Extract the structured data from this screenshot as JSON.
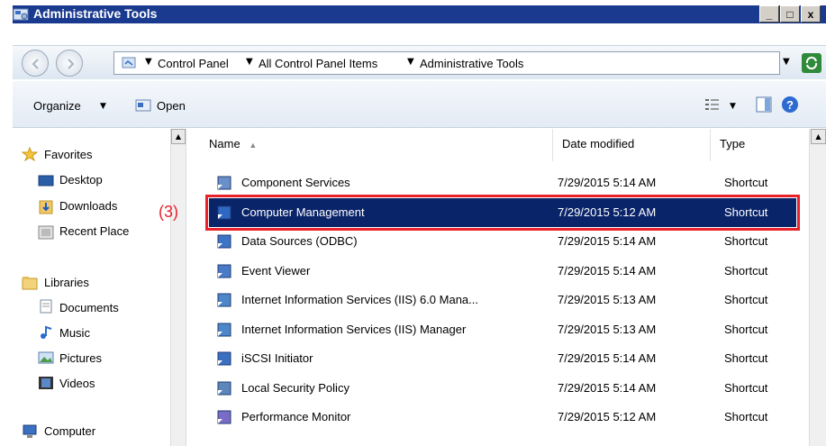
{
  "window": {
    "title": "Administrative Tools",
    "controls": {
      "minimize": "_",
      "maximize": "□",
      "close": "x"
    }
  },
  "address": {
    "crumbs": [
      "Control Panel",
      "All Control Panel Items",
      "Administrative Tools"
    ]
  },
  "toolbar": {
    "organize_label": "Organize",
    "open_label": "Open"
  },
  "nav": {
    "favorites": "Favorites",
    "desktop": "Desktop",
    "downloads": "Downloads",
    "recent": "Recent Place",
    "libraries": "Libraries",
    "documents": "Documents",
    "music": "Music",
    "pictures": "Pictures",
    "videos": "Videos",
    "computer": "Computer"
  },
  "columns": {
    "name": "Name",
    "date": "Date modified",
    "type": "Type"
  },
  "files": [
    {
      "name": "Component Services",
      "date": "7/29/2015 5:14 AM",
      "type": "Shortcut",
      "icon": "component-services-icon"
    },
    {
      "name": "Computer Management",
      "date": "7/29/2015 5:12 AM",
      "type": "Shortcut",
      "icon": "computer-management-icon",
      "selected": true
    },
    {
      "name": "Data Sources (ODBC)",
      "date": "7/29/2015 5:14 AM",
      "type": "Shortcut",
      "icon": "odbc-icon"
    },
    {
      "name": "Event Viewer",
      "date": "7/29/2015 5:14 AM",
      "type": "Shortcut",
      "icon": "event-viewer-icon"
    },
    {
      "name": "Internet Information Services (IIS) 6.0 Mana...",
      "date": "7/29/2015 5:13 AM",
      "type": "Shortcut",
      "icon": "iis6-icon"
    },
    {
      "name": "Internet Information Services (IIS) Manager",
      "date": "7/29/2015 5:13 AM",
      "type": "Shortcut",
      "icon": "iis-icon"
    },
    {
      "name": "iSCSI Initiator",
      "date": "7/29/2015 5:14 AM",
      "type": "Shortcut",
      "icon": "iscsi-icon"
    },
    {
      "name": "Local Security Policy",
      "date": "7/29/2015 5:14 AM",
      "type": "Shortcut",
      "icon": "security-policy-icon"
    },
    {
      "name": "Performance Monitor",
      "date": "7/29/2015 5:12 AM",
      "type": "Shortcut",
      "icon": "performance-monitor-icon"
    }
  ],
  "annotation": "(3)",
  "colors": {
    "titlebar": "#1a3a8f",
    "selection": "#0a246a",
    "highlight_box": "#e8222a"
  }
}
